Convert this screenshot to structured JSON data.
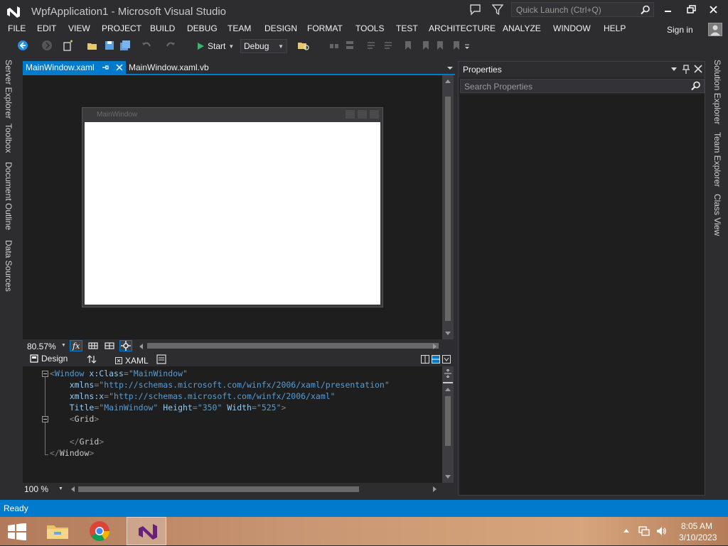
{
  "window": {
    "title": "WpfApplication1 - Microsoft Visual Studio",
    "quick_launch_placeholder": "Quick Launch (Ctrl+Q)",
    "sign_in": "Sign in"
  },
  "menu": [
    "FILE",
    "EDIT",
    "VIEW",
    "PROJECT",
    "BUILD",
    "DEBUG",
    "TEAM",
    "DESIGN",
    "FORMAT",
    "TOOLS",
    "TEST",
    "ARCHITECTURE",
    "ANALYZE",
    "WINDOW",
    "HELP"
  ],
  "toolbar": {
    "start_label": "Start",
    "config": "Debug"
  },
  "left_tabs": [
    "Server Explorer",
    "Toolbox",
    "Document Outline",
    "Data Sources"
  ],
  "right_tabs": [
    "Solution Explorer",
    "Team Explorer",
    "Class View"
  ],
  "doc_tabs": {
    "active": "MainWindow.xaml",
    "second": "MainWindow.xaml.vb"
  },
  "designer": {
    "window_caption": "MainWindow",
    "zoom": "80.57%"
  },
  "split": {
    "design_label": "Design",
    "xaml_label": "XAML"
  },
  "xaml": {
    "zoom": "100 %",
    "lines": [
      {
        "tag": "Window",
        "attr": "x:Class",
        "val": "\"MainWindow\""
      },
      {
        "attr": "xmlns",
        "val": "\"http://schemas.microsoft.com/winfx/2006/xaml/presentation\""
      },
      {
        "attr": "xmlns:x",
        "val": "\"http://schemas.microsoft.com/winfx/2006/xaml\""
      },
      {
        "attr1": "Title",
        "val1": "\"MainWindow\"",
        "attr2": "Height",
        "val2": "\"350\"",
        "attr3": "Width",
        "val3": "\"525\""
      },
      {
        "open": "Grid"
      },
      {
        "close": "Grid"
      },
      {
        "close": "Window"
      }
    ]
  },
  "properties": {
    "title": "Properties",
    "search_placeholder": "Search Properties"
  },
  "status": {
    "text": "Ready"
  },
  "taskbar": {
    "time": "8:05 AM",
    "date": "3/10/2023"
  },
  "colors": {
    "accent": "#007acc",
    "background": "#2d2d30",
    "editor": "#1e1e1e"
  }
}
